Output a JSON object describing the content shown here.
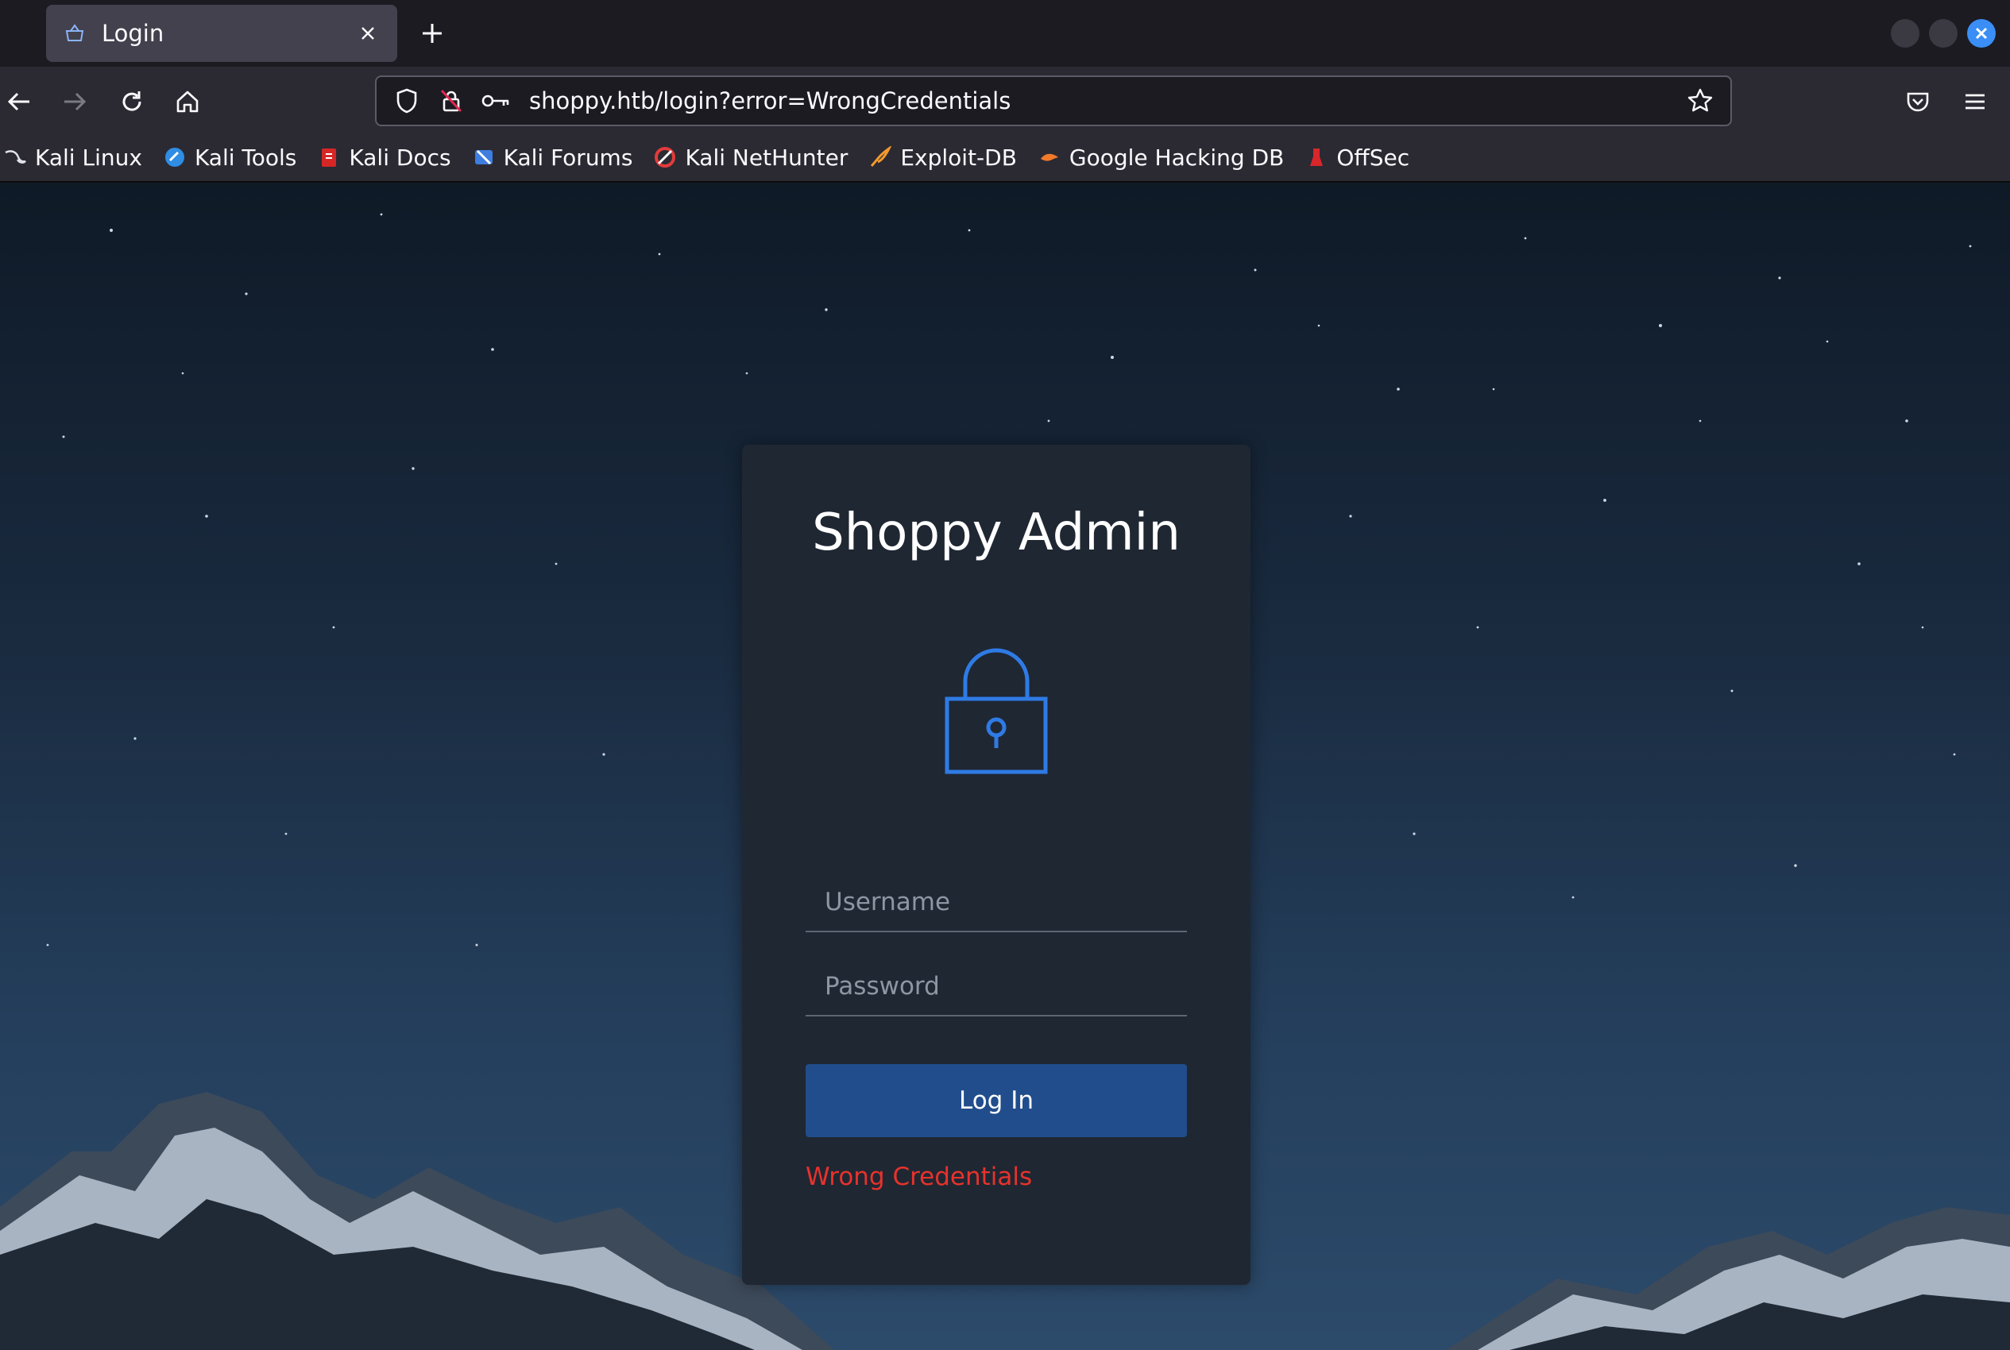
{
  "browser": {
    "tab": {
      "title": "Login"
    },
    "url": "shoppy.htb/login?error=WrongCredentials",
    "bookmarks": [
      {
        "label": "Kali Linux",
        "icon": "kali-dragon-icon"
      },
      {
        "label": "Kali Tools",
        "icon": "kali-tools-icon"
      },
      {
        "label": "Kali Docs",
        "icon": "kali-docs-icon"
      },
      {
        "label": "Kali Forums",
        "icon": "kali-forums-icon"
      },
      {
        "label": "Kali NetHunter",
        "icon": "nethunter-icon"
      },
      {
        "label": "Exploit-DB",
        "icon": "exploit-db-icon"
      },
      {
        "label": "Google Hacking DB",
        "icon": "ghdb-icon"
      },
      {
        "label": "OffSec",
        "icon": "offsec-icon"
      }
    ]
  },
  "login": {
    "title": "Shoppy Admin",
    "username_placeholder": "Username",
    "password_placeholder": "Password",
    "button_label": "Log In",
    "error_message": "Wrong Credentials"
  },
  "colors": {
    "accent": "#2f7be5",
    "button": "#214d8c",
    "error": "#e8322b",
    "card": "#1f2733"
  }
}
